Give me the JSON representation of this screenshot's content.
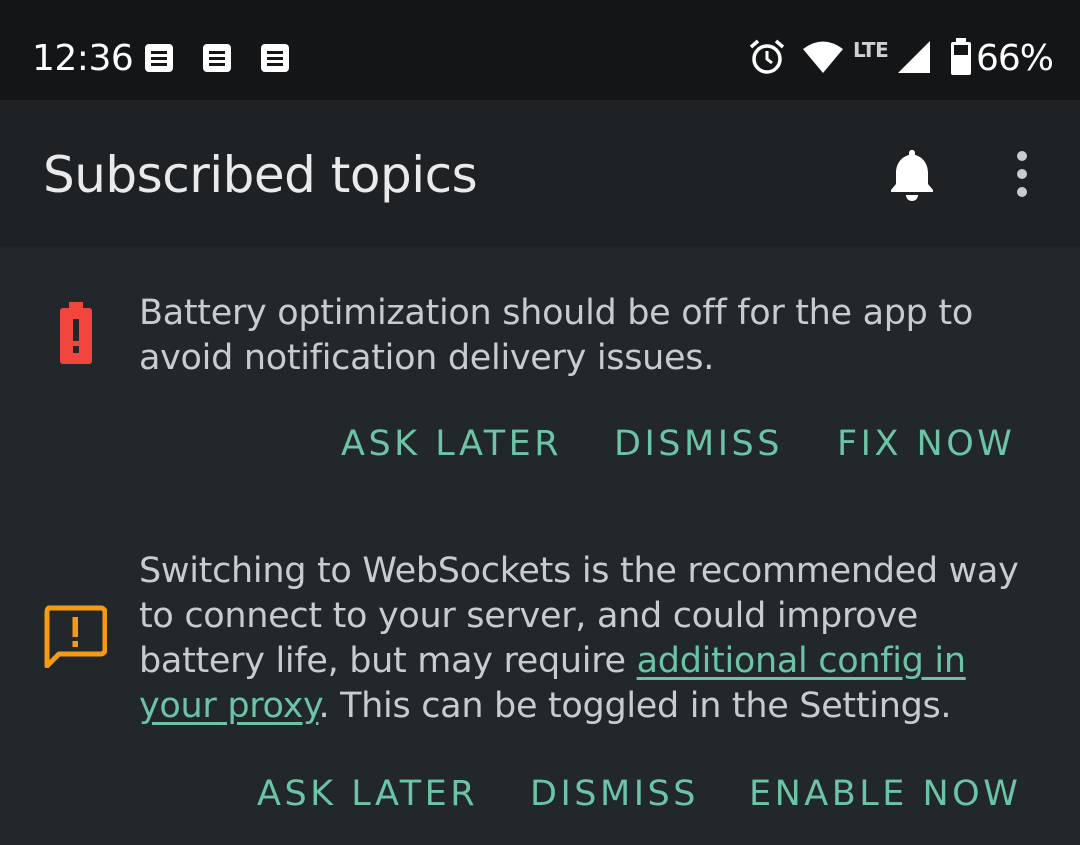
{
  "status_bar": {
    "time": "12:36",
    "network_label": "LTE",
    "battery_percent": "66%",
    "notification_icons": [
      "note-icon",
      "note-icon",
      "note-icon"
    ],
    "right_icons": [
      "alarm-icon",
      "wifi-icon",
      "cell-signal-icon",
      "battery-icon"
    ]
  },
  "app_bar": {
    "title": "Subscribed topics",
    "actions": [
      "bell-icon",
      "more-vert-icon"
    ]
  },
  "banners": [
    {
      "icon": "battery-alert-icon",
      "icon_color": "#f2453d",
      "message": "Battery optimization should be off for the app to avoid notification delivery issues.",
      "buttons": [
        "ASK LATER",
        "DISMISS",
        "FIX NOW"
      ]
    },
    {
      "icon": "feedback-warning-icon",
      "icon_color": "#f59a13",
      "message_before": "Switching to WebSockets is the recommended way to connect to your server, and could improve battery life, but may require ",
      "link_text": "additional config in your proxy",
      "message_after": ". This can be toggled in the Settings.",
      "buttons": [
        "ASK LATER",
        "DISMISS",
        "ENABLE NOW"
      ]
    }
  ],
  "colors": {
    "accent": "#6cc3a6",
    "background": "#22272b",
    "app_bar": "#1e2225",
    "status_bar": "#141516"
  }
}
